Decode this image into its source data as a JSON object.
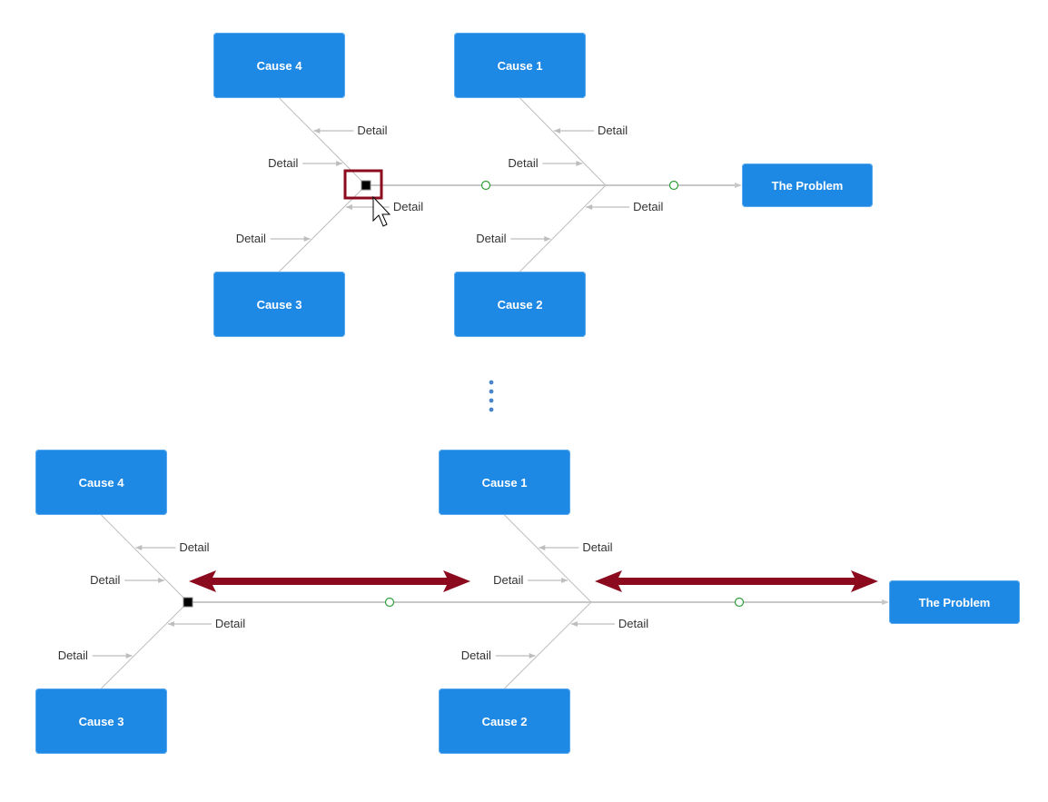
{
  "colors": {
    "node_fill": "#1e88e5",
    "node_text": "#ffffff",
    "line": "#c8c8c8",
    "bone_line": "#bdbdbd",
    "handle_green": "#2e9e3a",
    "selection_border": "#8b0a1e",
    "resize_arrow": "#8b0a1e",
    "ellipsis_dots": "#4a86c8"
  },
  "diagrams": [
    {
      "name": "before",
      "problem": "The Problem",
      "causes": [
        "Cause 4",
        "Cause 1",
        "Cause 3",
        "Cause 2"
      ],
      "detail_label": "Detail",
      "selected_handle": true,
      "cursor": "arrow-pointer"
    },
    {
      "name": "after",
      "problem": "The Problem",
      "causes": [
        "Cause 4",
        "Cause 1",
        "Cause 3",
        "Cause 2"
      ],
      "detail_label": "Detail",
      "stretch_arrows": 2
    }
  ],
  "separator": "vertical-ellipsis"
}
